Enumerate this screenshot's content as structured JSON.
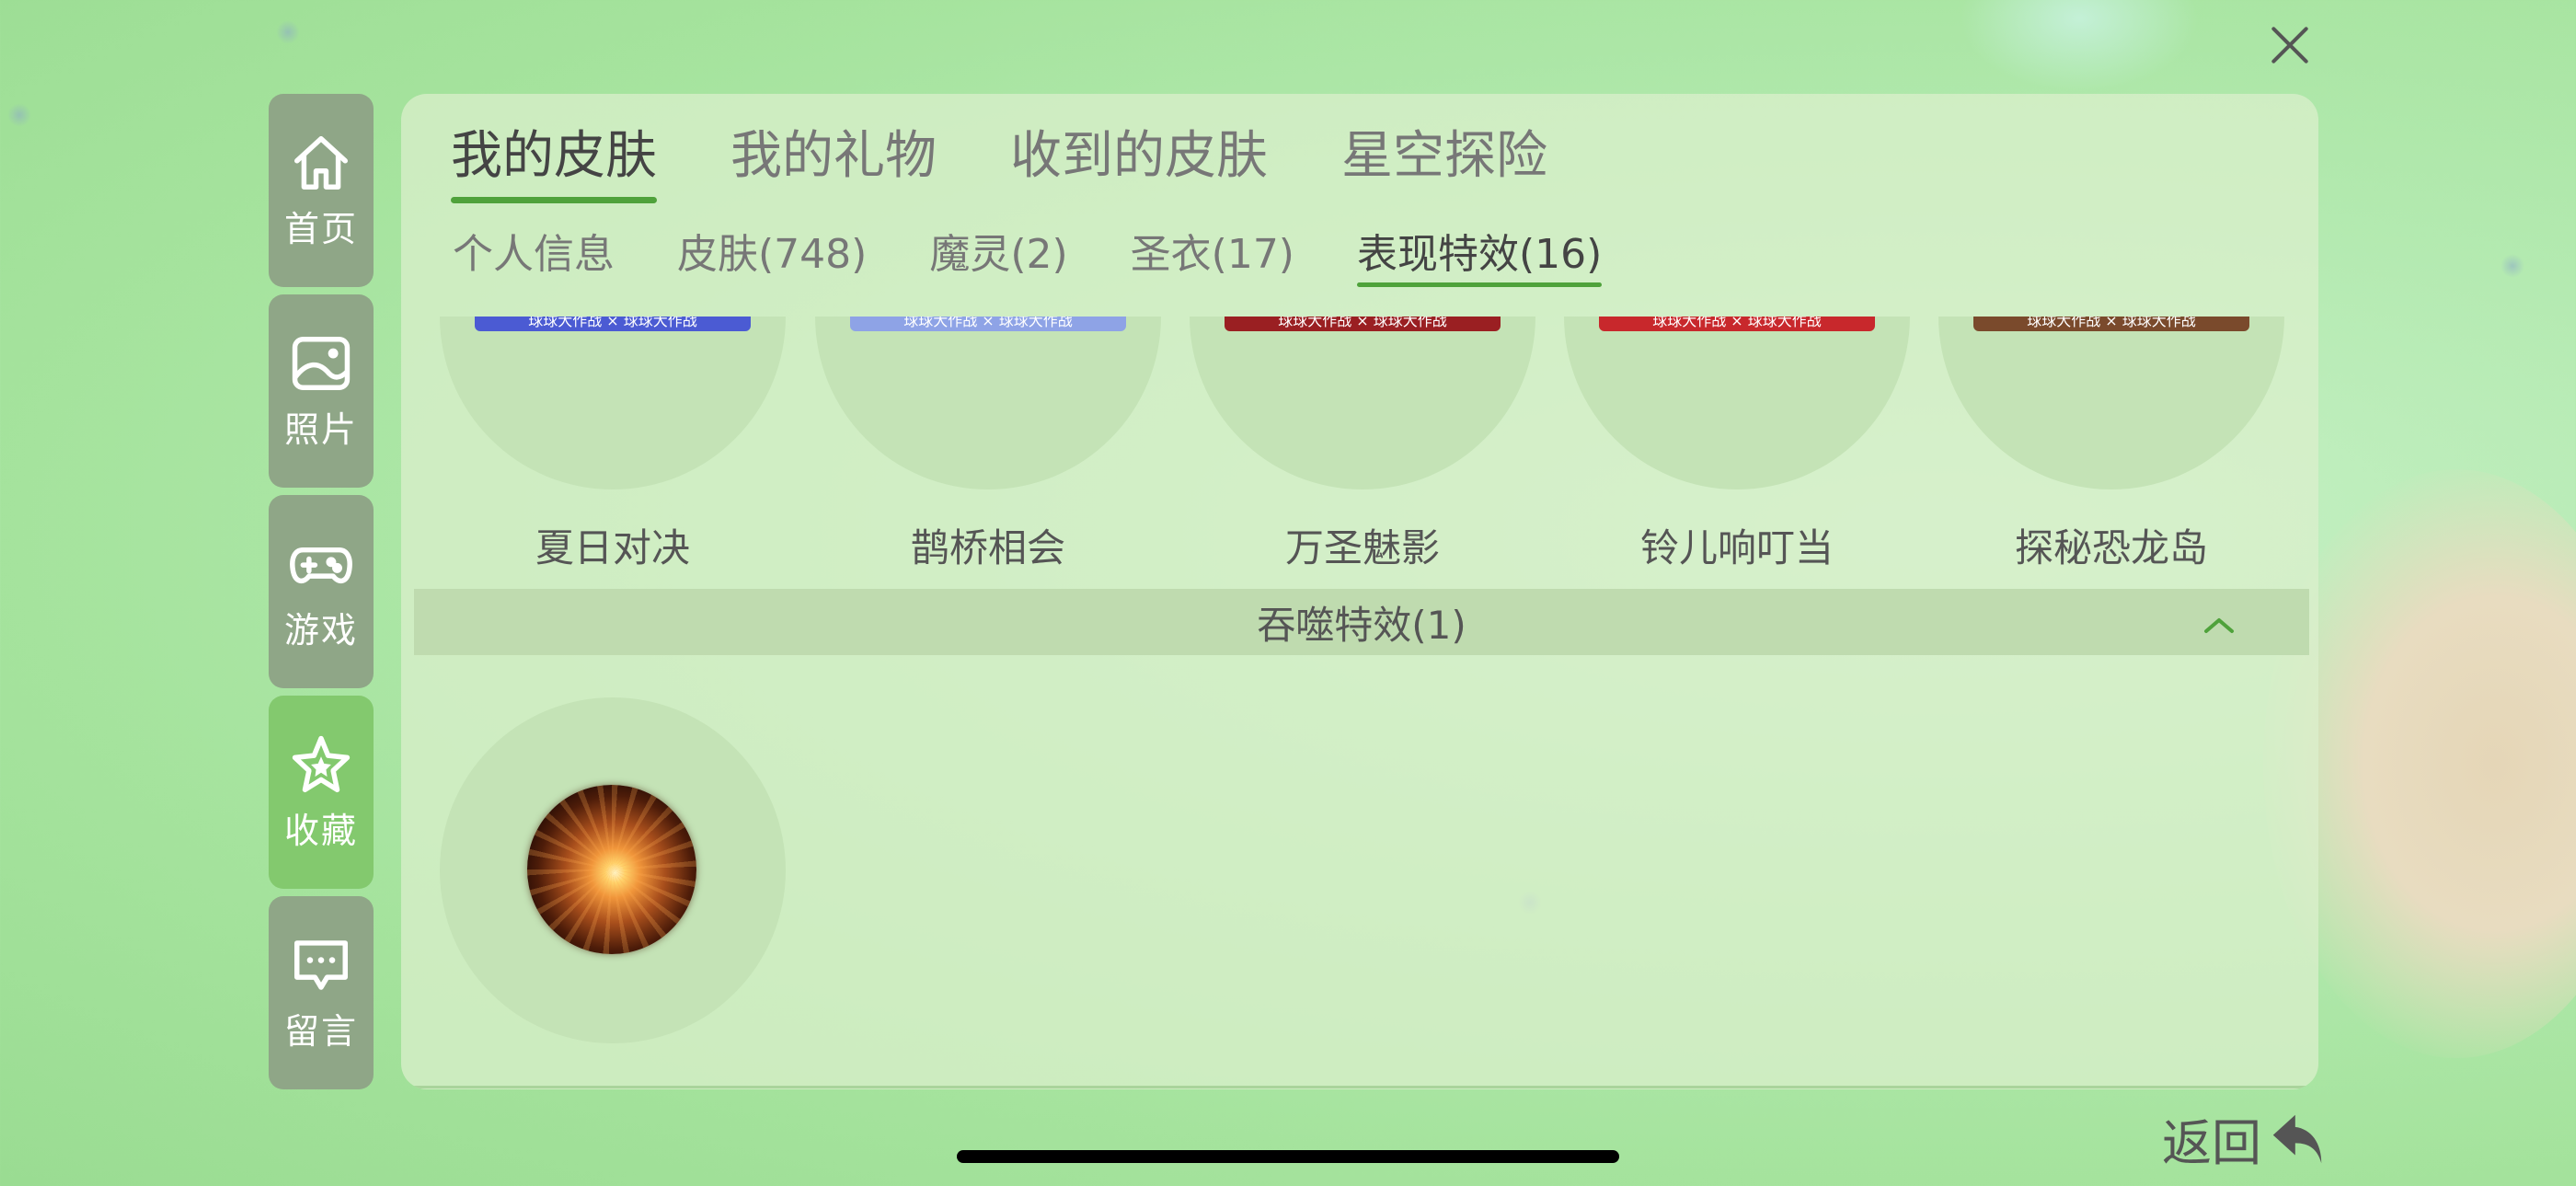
{
  "sidebar": {
    "items": [
      {
        "label": "首页",
        "icon": "home-icon"
      },
      {
        "label": "照片",
        "icon": "photo-icon"
      },
      {
        "label": "游戏",
        "icon": "gamepad-icon"
      },
      {
        "label": "收藏",
        "icon": "star-icon",
        "active": true
      },
      {
        "label": "留言",
        "icon": "message-icon"
      }
    ]
  },
  "tabs": [
    "我的皮肤",
    "我的礼物",
    "收到的皮肤",
    "星空探险"
  ],
  "subtabs": [
    "个人信息",
    "皮肤(748)",
    "魔灵(2)",
    "圣衣(17)",
    "表现特效(16)"
  ],
  "items": [
    {
      "name": "夏日对决",
      "banner_text": "球球大作战 × 球球大作战",
      "banner_color": "#4b5bd3"
    },
    {
      "name": "鹊桥相会",
      "banner_text": "球球大作战 × 球球大作战",
      "banner_color": "#8ea3e6"
    },
    {
      "name": "万圣魅影",
      "banner_text": "球球大作战 × 球球大作战",
      "banner_color": "#9a1f22"
    },
    {
      "name": "铃儿响叮当",
      "banner_text": "球球大作战 × 球球大作战",
      "banner_color": "#c8282c"
    },
    {
      "name": "探秘恐龙岛",
      "banner_text": "球球大作战 × 球球大作战",
      "banner_color": "#7a4a2c"
    }
  ],
  "section": {
    "title": "吞噬特效(1)"
  },
  "back": {
    "label": "返回"
  },
  "colors": {
    "accent": "#4fa23b",
    "sidebar_bg": "#8fa687",
    "sidebar_active": "#83c96e"
  }
}
